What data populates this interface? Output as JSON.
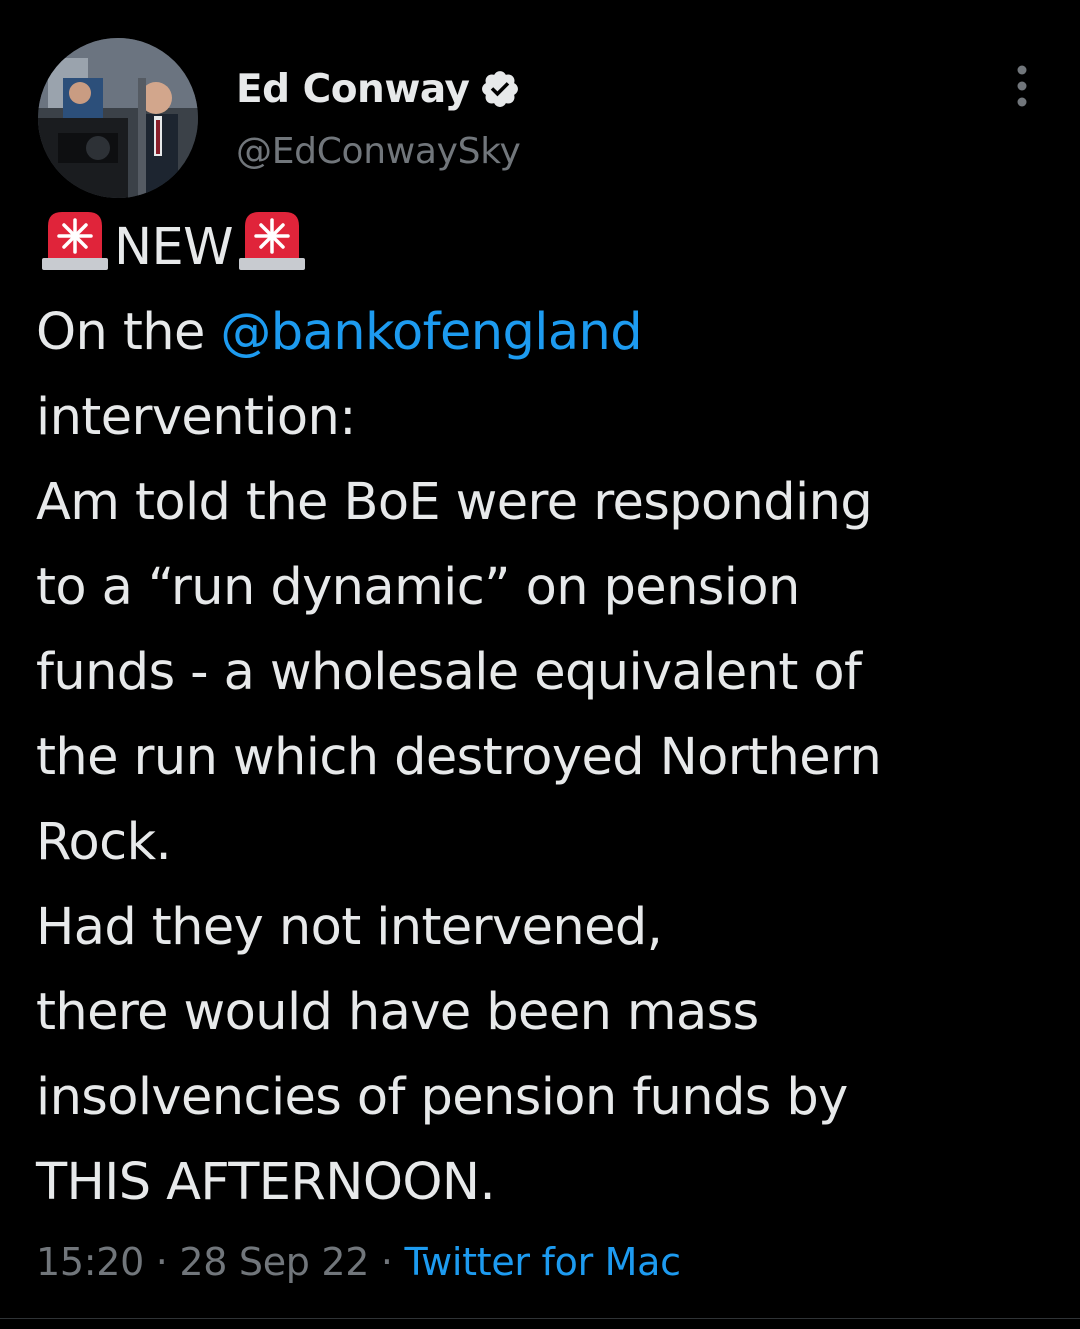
{
  "author": {
    "name": "Ed Conway",
    "handle": "@EdConwaySky",
    "verified_icon": "verified-badge-icon"
  },
  "tweet": {
    "new_label": "NEW",
    "line1_prefix": "On the ",
    "mention": "@bankofengland",
    "lines": [
      "intervention:",
      "Am told the BoE were responding",
      "to a “run dynamic” on pension",
      "funds - a wholesale equivalent of",
      "the run which destroyed Northern",
      "Rock.",
      "Had they not intervened,",
      "there would have been mass",
      "insolvencies of pension funds by",
      "THIS AFTERNOON."
    ]
  },
  "meta": {
    "time": "15:20",
    "sep1": " · ",
    "date": "28 Sep 22",
    "sep2": " · ",
    "source": "Twitter for Mac"
  },
  "colors": {
    "background": "#000000",
    "text": "#e7e9ea",
    "secondary": "#71767b",
    "accent": "#1d9bf0"
  }
}
